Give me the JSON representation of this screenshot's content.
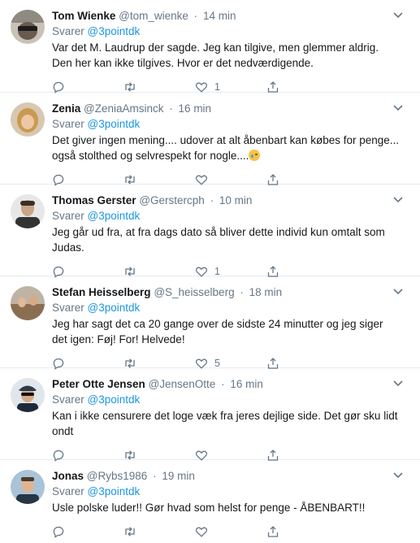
{
  "reply_prefix": "Svarer",
  "tweets": [
    {
      "name": "Tom Wienke",
      "handle": "@tom_wienke",
      "time": "14 min",
      "reply_to": "@3pointdk",
      "text": "Var det M. Laudrup der sagde. Jeg kan tilgive, men glemmer aldrig. Den her kan ikke tilgives. Hvor er det nedværdigende.",
      "likes": "1",
      "retweets": "",
      "replies": ""
    },
    {
      "name": "Zenia",
      "handle": "@ZeniaAmsinck",
      "time": "16 min",
      "reply_to": "@3pointdk",
      "text": "Det giver ingen mening.... udover at alt åbenbart kan købes for penge... også stolthed og selvrespekt for nogle....",
      "emoji": "crying-face",
      "likes": "",
      "retweets": "",
      "replies": ""
    },
    {
      "name": "Thomas Gerster",
      "handle": "@Gerstercph",
      "time": "10 min",
      "reply_to": "@3pointdk",
      "text": "Jeg går ud fra, at fra dags dato så bliver dette individ kun omtalt som Judas.",
      "likes": "1",
      "retweets": "",
      "replies": ""
    },
    {
      "name": "Stefan Heisselberg",
      "handle": "@S_heisselberg",
      "time": "18 min",
      "reply_to": "@3pointdk",
      "text": "Jeg har sagt det ca 20 gange over de sidste 24 minutter og jeg siger det igen: Føj! For! Helvede!",
      "likes": "5",
      "retweets": "",
      "replies": ""
    },
    {
      "name": "Peter Otte Jensen",
      "handle": "@JensenOtte",
      "time": "16 min",
      "reply_to": "@3pointdk",
      "text": "Kan i ikke censurere det loge væk fra jeres dejlige side. Det gør sku lidt ondt",
      "likes": "",
      "retweets": "",
      "replies": ""
    },
    {
      "name": "Jonas",
      "handle": "@Rybs1986",
      "time": "19 min",
      "reply_to": "@3pointdk",
      "text": "Usle polske luder!! Gør hvad som helst for penge - ÅBENBART!!",
      "likes": "",
      "retweets": "",
      "replies": ""
    }
  ],
  "colors": {
    "accent": "#1b95e0",
    "muted": "#657786",
    "text": "#14171a",
    "border": "#e6ecf0"
  },
  "icons": [
    "reply-icon",
    "retweet-icon",
    "like-icon",
    "share-icon",
    "chevron-down-icon"
  ]
}
